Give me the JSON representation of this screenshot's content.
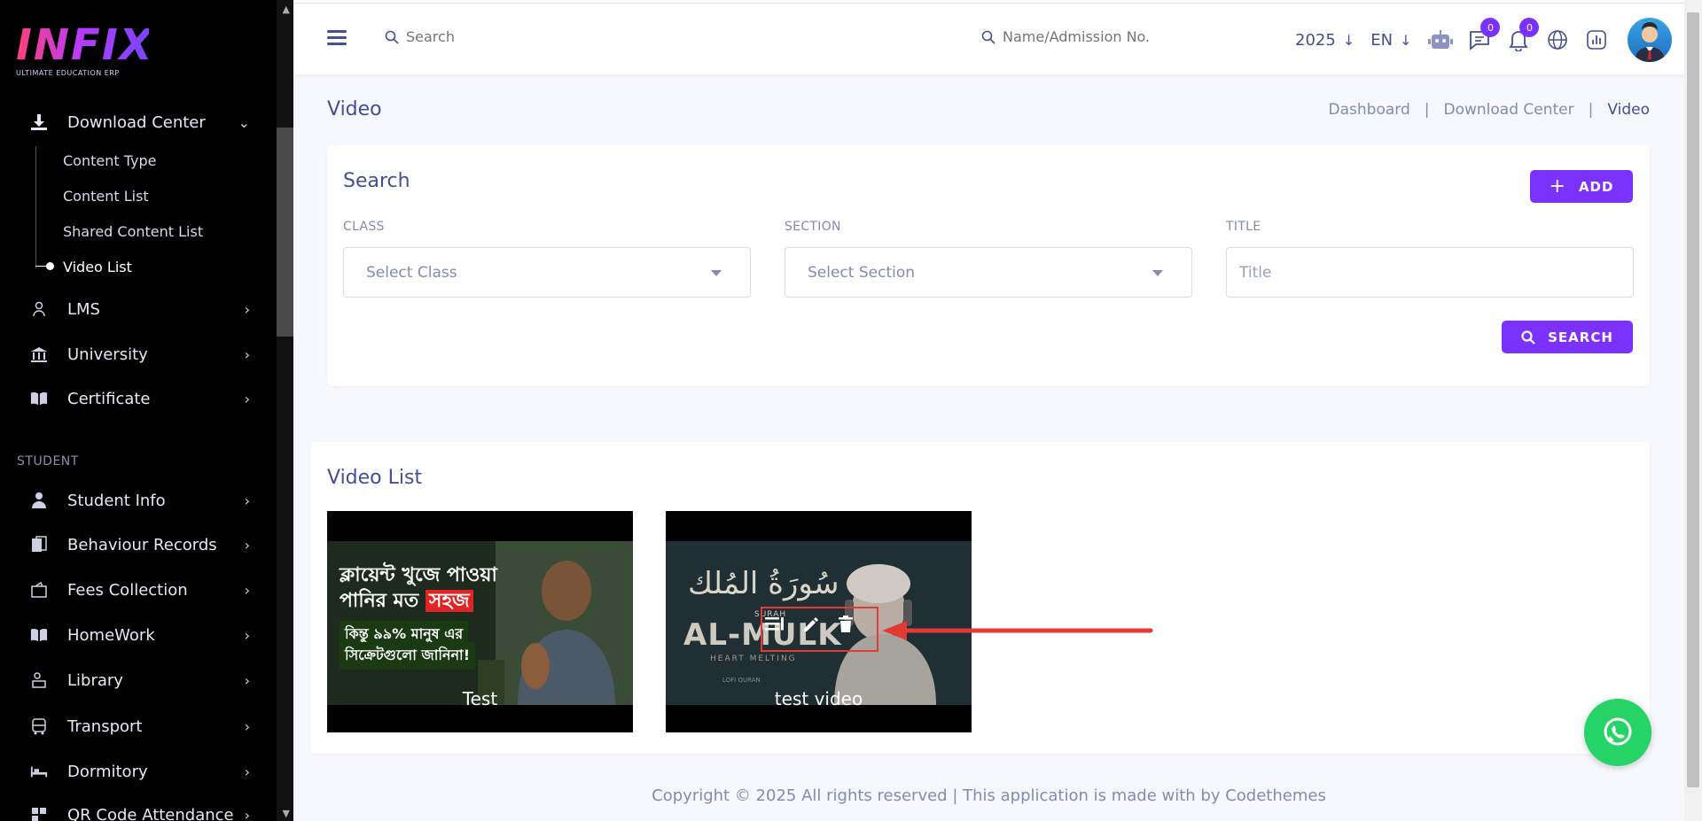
{
  "app": {
    "logo_text": "INFIX",
    "logo_subtitle": "ULTIMATE EDUCATION ERP",
    "colors": {
      "accent": "#7c32ff",
      "primary_text": "#415094",
      "sidebar_bg": "#000000",
      "whatsapp": "#25d366",
      "annotation": "#e53935"
    }
  },
  "sidebar": {
    "download_center": {
      "label": "Download Center",
      "icon": "download-icon"
    },
    "sub_items": [
      {
        "label": "Content Type"
      },
      {
        "label": "Content List"
      },
      {
        "label": "Shared Content List"
      },
      {
        "label": "Video List",
        "active": true
      }
    ],
    "items": [
      {
        "label": "LMS",
        "icon": "lms-icon"
      },
      {
        "label": "University",
        "icon": "university-icon"
      },
      {
        "label": "Certificate",
        "icon": "book-icon"
      }
    ],
    "section_label": "STUDENT",
    "student_items": [
      {
        "label": "Student Info",
        "icon": "student-icon"
      },
      {
        "label": "Behaviour Records",
        "icon": "records-icon"
      },
      {
        "label": "Fees Collection",
        "icon": "fees-icon"
      },
      {
        "label": "HomeWork",
        "icon": "homework-icon"
      },
      {
        "label": "Library",
        "icon": "library-icon"
      },
      {
        "label": "Transport",
        "icon": "bus-icon"
      },
      {
        "label": "Dormitory",
        "icon": "bed-icon"
      },
      {
        "label": "QR Code Attendance",
        "icon": "qr-icon"
      }
    ]
  },
  "header": {
    "search_placeholder": "Search",
    "student_search_placeholder": "Name/Admission No.",
    "year": "2025",
    "language": "EN",
    "chat_badge": "0",
    "notification_badge": "0"
  },
  "page": {
    "title": "Video",
    "breadcrumb": [
      "Dashboard",
      "Download Center",
      "Video"
    ]
  },
  "search_card": {
    "title": "Search",
    "add_label": "ADD",
    "class_label": "CLASS",
    "class_value": "Select Class",
    "section_label": "SECTION",
    "section_value": "Select Section",
    "title_label": "TITLE",
    "title_placeholder": "Title",
    "search_button": "SEARCH"
  },
  "video_list": {
    "title": "Video List",
    "videos": [
      {
        "caption": "Test",
        "thumb_line1": "ক্লায়েন্ট খুজে পাওয়া",
        "thumb_line2": "পানির মত",
        "thumb_highlight": "সহজ",
        "thumb_line3": "কিন্তু ৯৯% মানুষ এর",
        "thumb_line4": "সিক্রেটগুলো জানিনা!"
      },
      {
        "caption": "test video",
        "thumb_arabic": "سُورَةُ المُلك",
        "thumb_title": "AL-MULK",
        "thumb_surah": "SURAH",
        "thumb_sub": "HEART MELTING",
        "thumb_author": "LOFI QURAN"
      }
    ]
  },
  "footer": {
    "text": "Copyright © 2025 All rights reserved | This application is made with by Codethemes"
  }
}
